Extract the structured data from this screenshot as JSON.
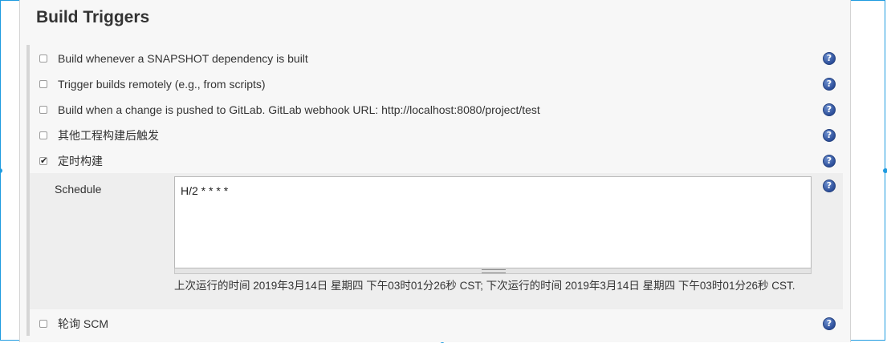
{
  "section": {
    "title": "Build Triggers"
  },
  "triggers": [
    {
      "label": "Build whenever a SNAPSHOT dependency is built",
      "checked": false
    },
    {
      "label": "Trigger builds remotely (e.g., from scripts)",
      "checked": false
    },
    {
      "label": "Build when a change is pushed to GitLab. GitLab webhook URL: http://localhost:8080/project/test",
      "checked": false
    },
    {
      "label": "其他工程构建后触发",
      "checked": false
    },
    {
      "label": "定时构建",
      "checked": true
    },
    {
      "label": "轮询 SCM",
      "checked": false
    }
  ],
  "schedule": {
    "label": "Schedule",
    "value": "H/2 * * * *",
    "info": "上次运行的时间 2019年3月14日 星期四 下午03时01分26秒 CST; 下次运行的时间 2019年3月14日 星期四 下午03时01分26秒 CST."
  },
  "help_icon": {
    "glyph": "?",
    "icon": "help-icon",
    "color": "#2d4f9a"
  },
  "accent_color": "#1e9be0"
}
